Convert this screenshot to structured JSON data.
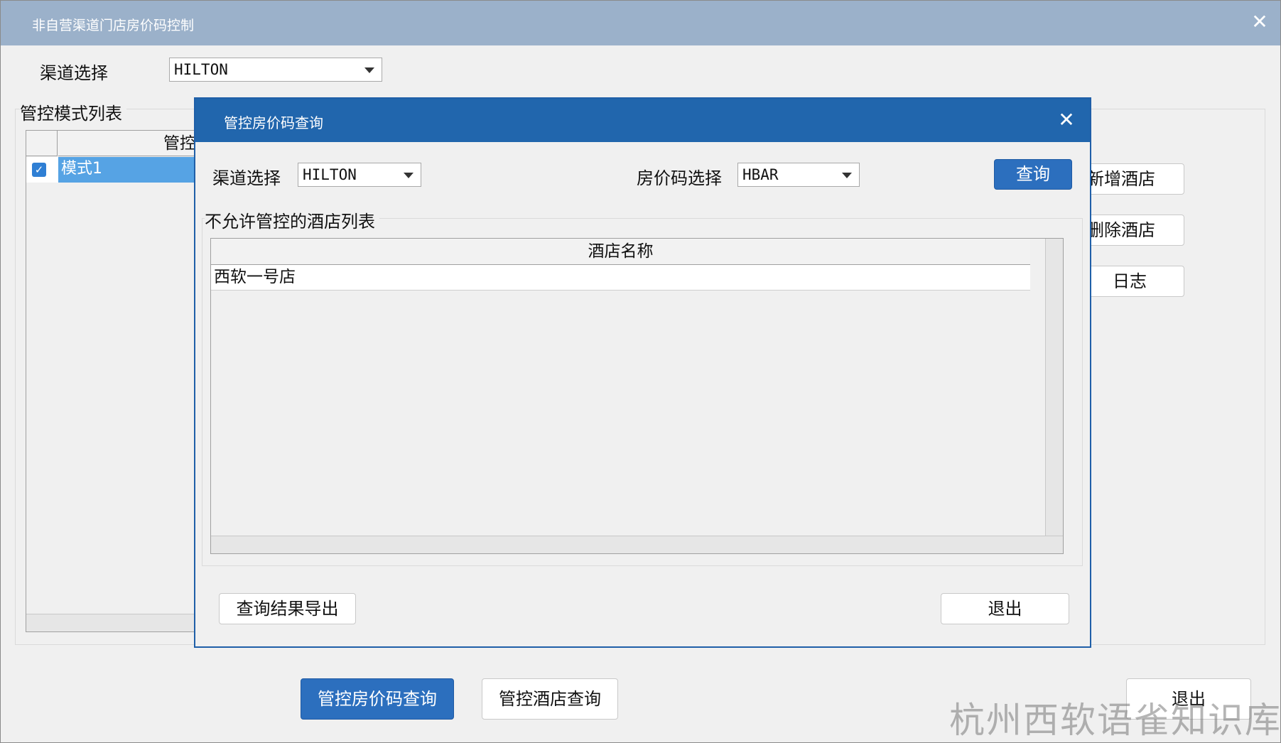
{
  "outer_window": {
    "title": "非自营渠道门店房价码控制",
    "close_glyph": "✕",
    "channel_label": "渠道选择",
    "channel_value": "HILTON",
    "mode_list_label": "管控模式列表",
    "mode_column_header": "管控模式",
    "mode_rows": [
      {
        "checked": true,
        "label": "模式1"
      }
    ],
    "side_buttons": {
      "add_hotel": "新增酒店",
      "delete_hotel": "删除酒店",
      "log": "日志"
    },
    "bottom_buttons": {
      "rate_code_query": "管控房价码查询",
      "hotel_query": "管控酒店查询",
      "exit": "退出"
    }
  },
  "modal": {
    "title": "管控房价码查询",
    "close_glyph": "✕",
    "channel_label": "渠道选择",
    "channel_value": "HILTON",
    "rate_code_label": "房价码选择",
    "rate_code_value": "HBAR",
    "query_button": "查询",
    "list_label": "不允许管控的酒店列表",
    "table_header": "酒店名称",
    "rows": [
      "西软一号店"
    ],
    "export_button": "查询结果导出",
    "exit_button": "退出"
  },
  "watermark": "杭州西软语雀知识库",
  "colors": {
    "outer_title_bar": "#9bb1ca",
    "modal_title_bar": "#2166ad",
    "primary_button": "#2c6fbe",
    "selected_row": "#56a3e4"
  }
}
